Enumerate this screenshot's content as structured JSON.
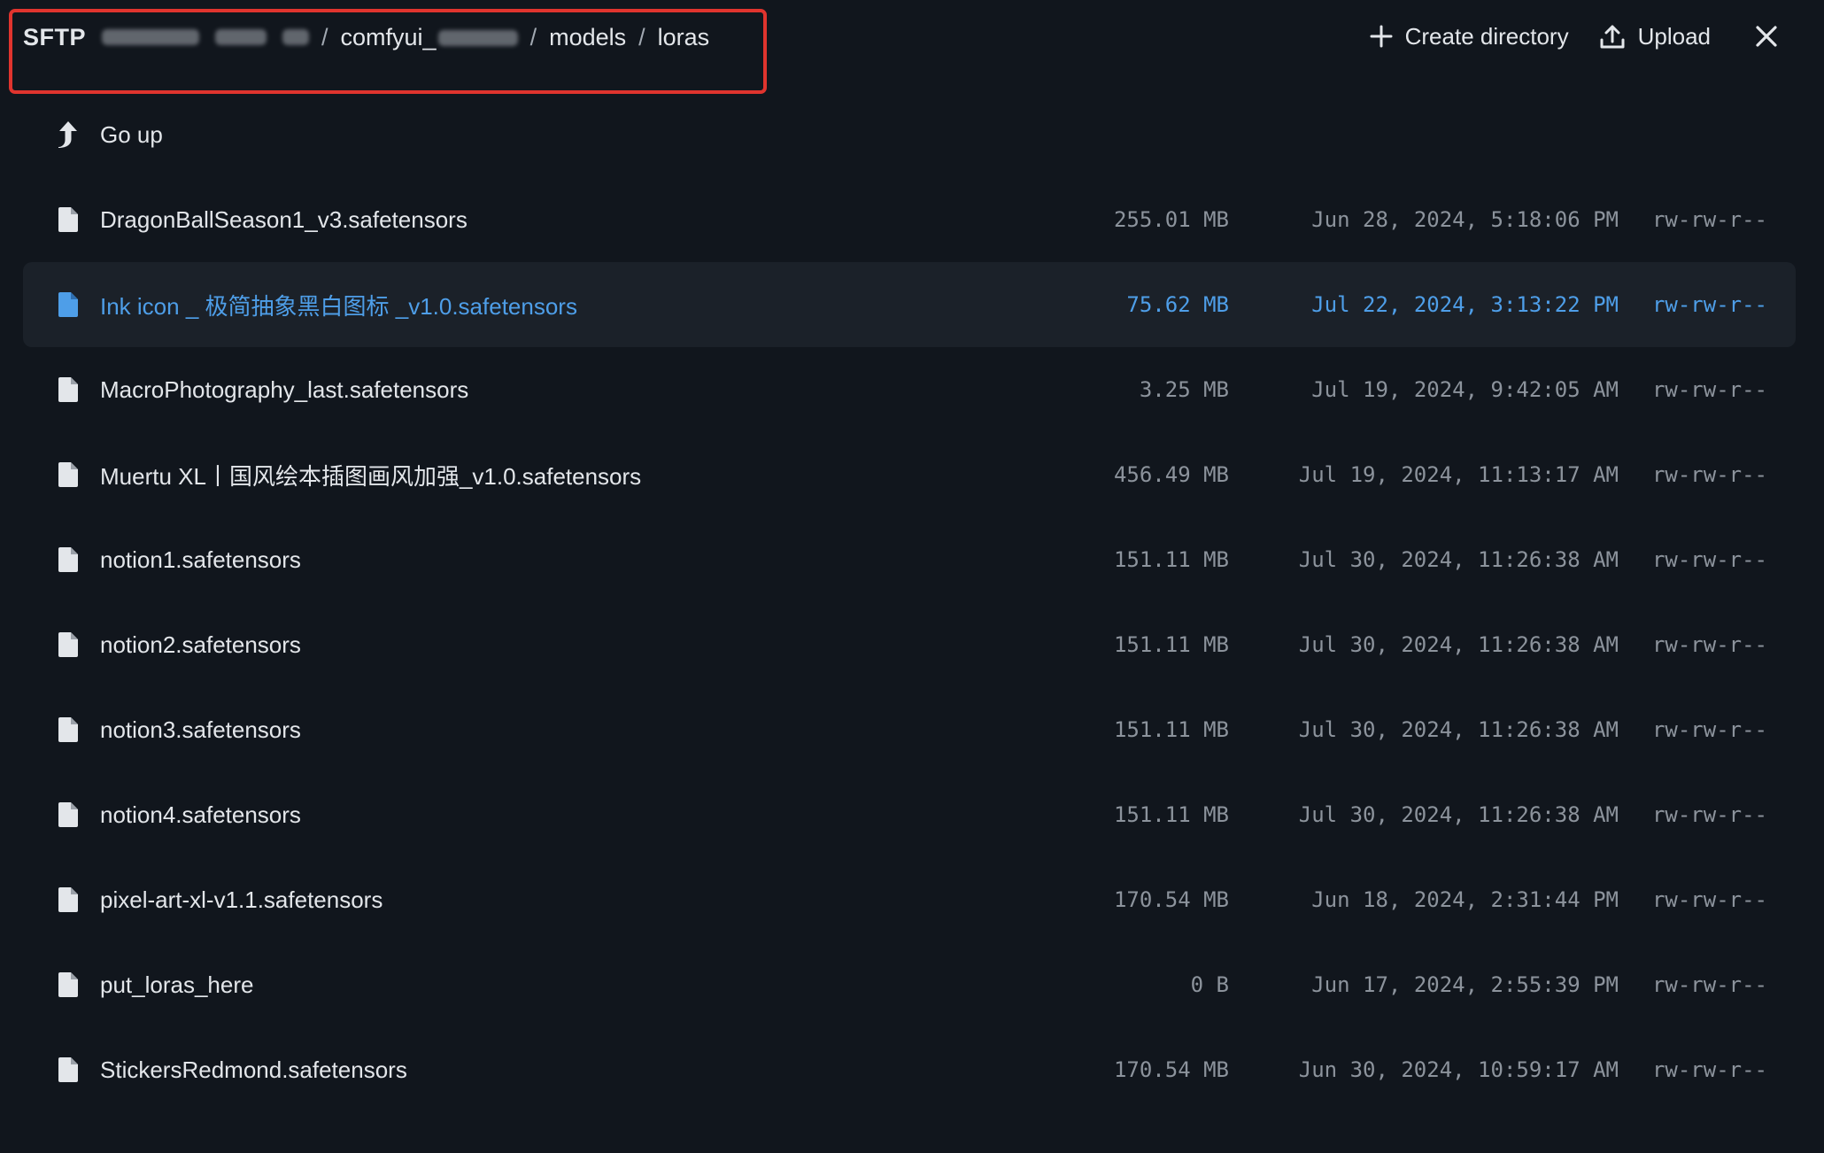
{
  "header": {
    "breadcrumb_root": "SFTP",
    "breadcrumb_sep": "/",
    "breadcrumb_dir_1": "comfyui_",
    "breadcrumb_dir_2": "models",
    "breadcrumb_dir_3": "loras",
    "create_directory_label": "Create directory",
    "upload_label": "Upload"
  },
  "go_up_label": "Go up",
  "colors": {
    "background": "#11161d",
    "selected_row": "#1b2129",
    "accent": "#4e9ee8",
    "highlight_border": "#e0342e"
  },
  "files": [
    {
      "name": "DragonBallSeason1_v3.safetensors",
      "size": "255.01 MB",
      "date": "Jun 28, 2024, 5:18:06 PM",
      "perm": "rw-rw-r--"
    },
    {
      "name": "Ink icon _ 极简抽象黑白图标 _v1.0.safetensors",
      "size": "75.62 MB",
      "date": "Jul 22, 2024, 3:13:22 PM",
      "perm": "rw-rw-r--"
    },
    {
      "name": "MacroPhotography_last.safetensors",
      "size": "3.25 MB",
      "date": "Jul 19, 2024, 9:42:05 AM",
      "perm": "rw-rw-r--"
    },
    {
      "name": "Muertu XL丨国风绘本插图画风加强_v1.0.safetensors",
      "size": "456.49 MB",
      "date": "Jul 19, 2024, 11:13:17 AM",
      "perm": "rw-rw-r--"
    },
    {
      "name": "notion1.safetensors",
      "size": "151.11 MB",
      "date": "Jul 30, 2024, 11:26:38 AM",
      "perm": "rw-rw-r--"
    },
    {
      "name": "notion2.safetensors",
      "size": "151.11 MB",
      "date": "Jul 30, 2024, 11:26:38 AM",
      "perm": "rw-rw-r--"
    },
    {
      "name": "notion3.safetensors",
      "size": "151.11 MB",
      "date": "Jul 30, 2024, 11:26:38 AM",
      "perm": "rw-rw-r--"
    },
    {
      "name": "notion4.safetensors",
      "size": "151.11 MB",
      "date": "Jul 30, 2024, 11:26:38 AM",
      "perm": "rw-rw-r--"
    },
    {
      "name": "pixel-art-xl-v1.1.safetensors",
      "size": "170.54 MB",
      "date": "Jun 18, 2024, 2:31:44 PM",
      "perm": "rw-rw-r--"
    },
    {
      "name": "put_loras_here",
      "size": "0 B",
      "date": "Jun 17, 2024, 2:55:39 PM",
      "perm": "rw-rw-r--"
    },
    {
      "name": "StickersRedmond.safetensors",
      "size": "170.54 MB",
      "date": "Jun 30, 2024, 10:59:17 AM",
      "perm": "rw-rw-r--"
    }
  ]
}
